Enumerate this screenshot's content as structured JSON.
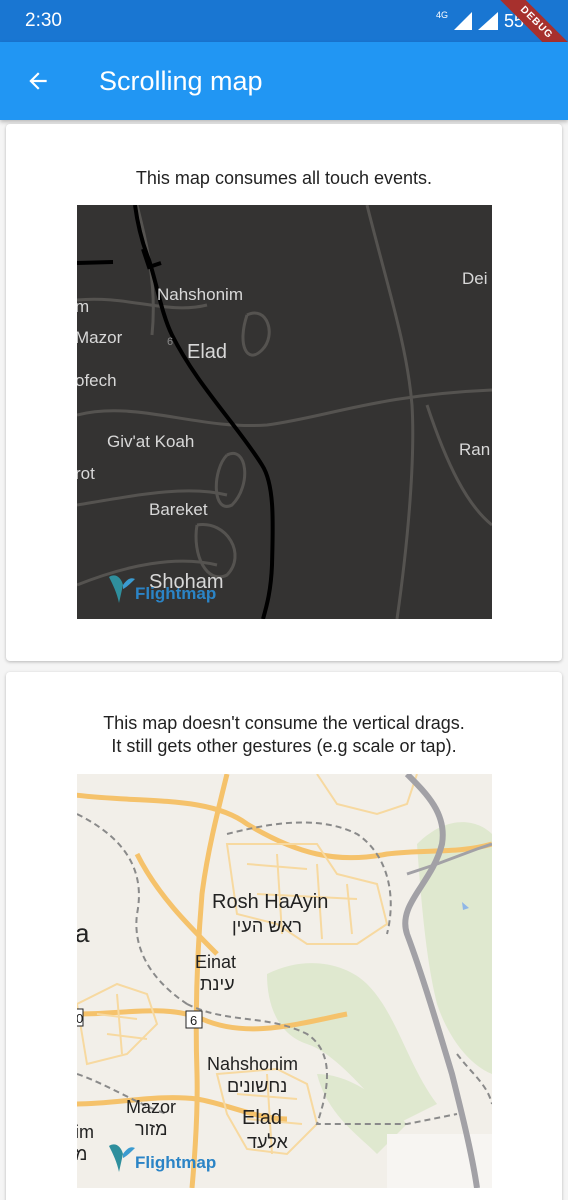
{
  "status_bar": {
    "time": "2:30",
    "network": "4G",
    "battery": "55%",
    "debug_banner": "DEBUG"
  },
  "app_bar": {
    "title": "Scrolling map"
  },
  "card1": {
    "text": "This map consumes all touch events.",
    "map": {
      "labels": [
        "Nahshonim",
        "Elad",
        "Mazor",
        "ofech",
        "Giv'at Koah",
        "rot",
        "Bareket",
        "Shoham",
        "Dei",
        "Ran",
        "m",
        "6"
      ],
      "attribution": "Flightmap"
    }
  },
  "card2": {
    "text_line1": "This map doesn't consume the vertical drags.",
    "text_line2": "It still gets other gestures (e.g scale or tap).",
    "map": {
      "labels": [
        "Rosh HaAyin",
        "ראש העין",
        "Einat",
        "עינת",
        "Nahshonim",
        "נחשונים",
        "Mazor",
        "מזור",
        "Elad",
        "אלעד",
        "6",
        "a",
        "0",
        "im",
        "מ"
      ],
      "attribution": "Flightmap"
    }
  }
}
